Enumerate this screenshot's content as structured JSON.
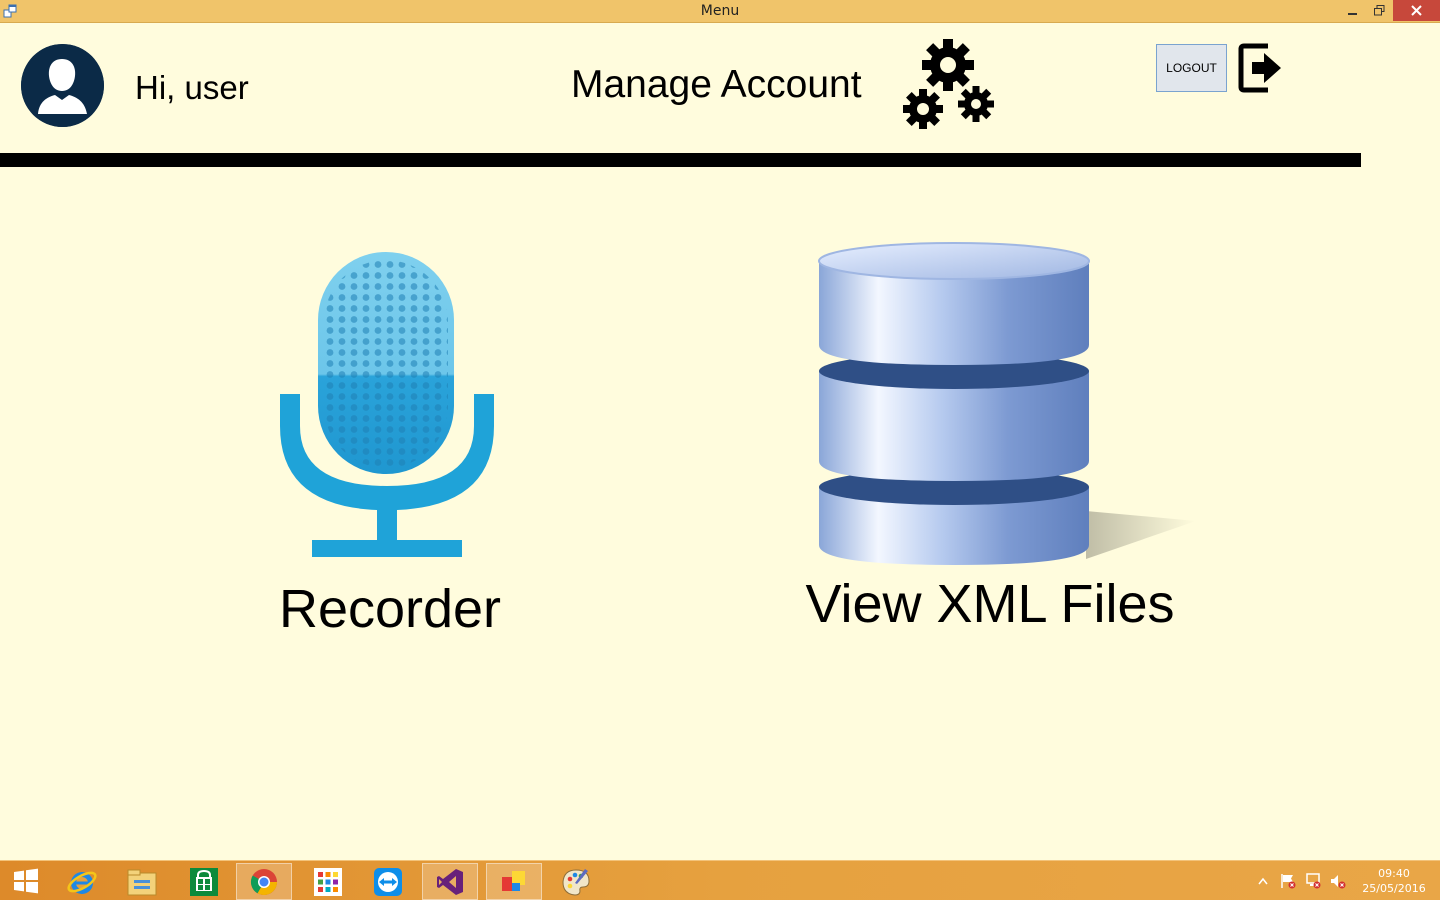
{
  "window": {
    "title": "Menu"
  },
  "header": {
    "greeting": "Hi, user",
    "manage_account": "Manage Account",
    "logout_label": "LOGOUT"
  },
  "tiles": [
    {
      "label": "Recorder",
      "icon": "microphone-icon"
    },
    {
      "label": "View XML Files",
      "icon": "database-icon"
    }
  ],
  "taskbar": {
    "items": [
      "start",
      "internet-explorer",
      "file-explorer",
      "store",
      "chrome",
      "apps",
      "teamviewer",
      "visual-studio",
      "app-window",
      "paint"
    ],
    "clock_time": "09:40",
    "clock_date": "25/05/2016"
  },
  "colors": {
    "background": "#fffcdd",
    "titlebar": "#f0c46a",
    "taskbar": "#e6a13f",
    "close_button": "#c7483b",
    "accent_blue": "#29a3db"
  }
}
